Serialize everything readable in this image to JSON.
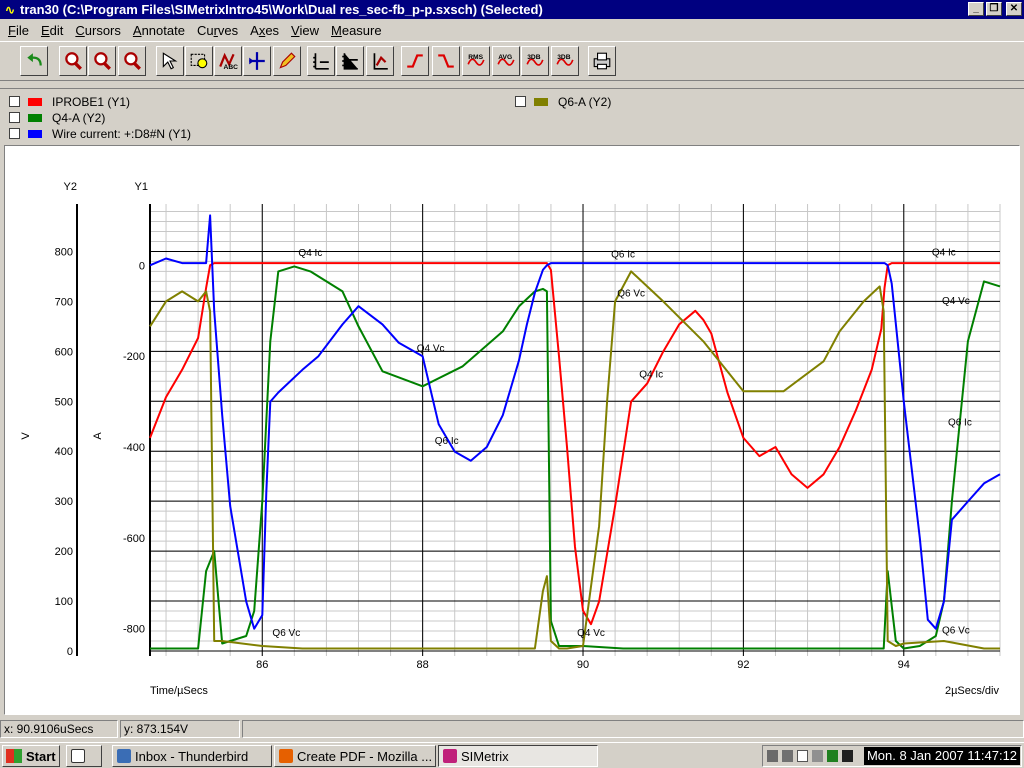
{
  "window": {
    "title": "tran30 (C:\\Program Files\\SIMetrixIntro45\\Work\\Dual res_sec-fb_p-p.sxsch) (Selected)",
    "icon": "sine-wave-icon"
  },
  "menu": [
    {
      "label": "File",
      "hot": "F",
      "rest": "ile"
    },
    {
      "label": "Edit",
      "hot": "E",
      "rest": "dit"
    },
    {
      "label": "Cursors",
      "hot": "C",
      "rest": "ursors"
    },
    {
      "label": "Annotate",
      "hot": "A",
      "rest": "nnotate"
    },
    {
      "label": "Curves",
      "pre": "Cu",
      "hot": "r",
      "rest": "ves"
    },
    {
      "label": "Axes",
      "pre": "A",
      "hot": "x",
      "rest": "es"
    },
    {
      "label": "View",
      "hot": "V",
      "rest": "iew"
    },
    {
      "label": "Measure",
      "hot": "M",
      "rest": "easure"
    }
  ],
  "toolbar": {
    "buttons": [
      {
        "name": "undo-icon"
      },
      {
        "name": "zoom-in-icon"
      },
      {
        "name": "zoom-out-icon"
      },
      {
        "name": "zoom-fit-icon"
      },
      {
        "name": "cursor-select-icon"
      },
      {
        "name": "zoom-box-icon"
      },
      {
        "name": "curve-label-icon"
      },
      {
        "name": "marker-icon"
      },
      {
        "name": "annotate-pen-icon"
      },
      {
        "name": "new-grid-icon"
      },
      {
        "name": "new-axis-icon"
      },
      {
        "name": "axis-scale-icon"
      },
      {
        "name": "rise-time-icon"
      },
      {
        "name": "fall-time-icon"
      },
      {
        "name": "rms-icon",
        "text": "RMS"
      },
      {
        "name": "avg-icon",
        "text": "AVG"
      },
      {
        "name": "3db-high-icon",
        "text": "3DB"
      },
      {
        "name": "3db-low-icon",
        "text": "3DB"
      },
      {
        "name": "print-icon"
      }
    ]
  },
  "legend": [
    {
      "label": "IPROBE1 (Y1)",
      "color": "#ff0000"
    },
    {
      "label": "Q4-A (Y2)",
      "color": "#008000"
    },
    {
      "label": "Wire current: +:D8#N (Y1)",
      "color": "#0000ff"
    },
    {
      "label": "Q6-A (Y2)",
      "color": "#808000"
    }
  ],
  "chart_data": {
    "type": "line",
    "xlabel": "Time/µSecs",
    "x_div_label": "2µSecs/div",
    "xlim": [
      84.6,
      95.2
    ],
    "x_ticks": [
      86,
      88,
      90,
      92,
      94
    ],
    "grid": true,
    "y2": {
      "title": "Y2",
      "unit_label": "V",
      "ylim": [
        -10,
        895
      ],
      "ticks": [
        0,
        100,
        200,
        300,
        400,
        500,
        600,
        700,
        800
      ]
    },
    "y1": {
      "title": "Y1",
      "unit_label": "A",
      "ylim": [
        -860,
        135
      ],
      "ticks": [
        0,
        -200,
        -400,
        -600,
        -800
      ]
    },
    "series": [
      {
        "name": "IPROBE1 (Y1)",
        "axis": "y1",
        "color": "#ff0000",
        "x": [
          84.6,
          84.8,
          85.0,
          85.2,
          85.3,
          85.35,
          85.4,
          85.5,
          86.0,
          86.5,
          87.0,
          87.5,
          88.0,
          88.5,
          89.0,
          89.4,
          89.5,
          89.55,
          89.6,
          89.7,
          89.8,
          89.9,
          90.0,
          90.1,
          90.2,
          90.4,
          90.6,
          90.8,
          91.0,
          91.2,
          91.4,
          91.5,
          91.6,
          91.8,
          92.0,
          92.2,
          92.4,
          92.6,
          92.8,
          93.0,
          93.2,
          93.4,
          93.6,
          93.72,
          93.76,
          93.8,
          93.85,
          94.0,
          94.5,
          95.0,
          95.2
        ],
        "y": [
          -380,
          -290,
          -230,
          -160,
          -50,
          0,
          5,
          5,
          5,
          5,
          5,
          5,
          5,
          5,
          5,
          5,
          5,
          5,
          -10,
          -200,
          -400,
          -620,
          -760,
          -790,
          -740,
          -530,
          -300,
          -260,
          -190,
          -130,
          -100,
          -120,
          -150,
          -280,
          -380,
          -420,
          -400,
          -460,
          -490,
          -460,
          -400,
          -320,
          -230,
          -140,
          -50,
          0,
          5,
          5,
          5,
          5,
          5
        ]
      },
      {
        "name": "Q4-A (Y2)",
        "axis": "y2",
        "color": "#008000",
        "x": [
          84.6,
          85.0,
          85.2,
          85.3,
          85.4,
          85.5,
          85.6,
          85.8,
          85.9,
          86.0,
          86.1,
          86.2,
          86.4,
          86.6,
          87.0,
          87.2,
          87.5,
          88.0,
          88.5,
          89.0,
          89.2,
          89.4,
          89.5,
          89.55,
          89.6,
          89.7,
          90.0,
          90.5,
          91.0,
          91.5,
          92.0,
          92.5,
          93.0,
          93.2,
          93.5,
          93.6,
          93.7,
          93.75,
          93.8,
          93.9,
          94.0,
          94.2,
          94.4,
          94.5,
          94.6,
          94.8,
          95.0,
          95.2
        ],
        "y": [
          5,
          5,
          5,
          160,
          200,
          15,
          20,
          30,
          80,
          300,
          620,
          760,
          770,
          760,
          720,
          650,
          560,
          530,
          570,
          640,
          690,
          720,
          725,
          720,
          60,
          10,
          10,
          5,
          5,
          5,
          5,
          5,
          5,
          5,
          5,
          5,
          5,
          5,
          160,
          20,
          5,
          10,
          30,
          100,
          300,
          620,
          740,
          730
        ]
      },
      {
        "name": "Wire current: +:D8#N (Y1)",
        "axis": "y1",
        "color": "#0000ff",
        "x": [
          84.6,
          84.8,
          85.0,
          85.2,
          85.3,
          85.35,
          85.4,
          85.5,
          85.6,
          85.8,
          85.9,
          86.0,
          86.05,
          86.1,
          86.2,
          86.5,
          86.7,
          87.0,
          87.2,
          87.5,
          87.7,
          88.0,
          88.2,
          88.4,
          88.6,
          88.8,
          89.0,
          89.2,
          89.3,
          89.4,
          89.5,
          89.55,
          89.6,
          90.0,
          90.5,
          91.0,
          92.0,
          93.0,
          93.5,
          93.72,
          93.76,
          93.8,
          93.85,
          94.0,
          94.2,
          94.3,
          94.4,
          94.5,
          94.6,
          94.8,
          95.0,
          95.2
        ],
        "y": [
          0,
          15,
          5,
          5,
          5,
          110,
          -100,
          -330,
          -530,
          -740,
          -800,
          -770,
          -500,
          -300,
          -280,
          -230,
          -200,
          -130,
          -90,
          -130,
          -170,
          -200,
          -350,
          -410,
          -430,
          -400,
          -330,
          -210,
          -130,
          -60,
          -10,
          0,
          5,
          5,
          5,
          5,
          5,
          5,
          5,
          5,
          5,
          0,
          -40,
          -300,
          -600,
          -780,
          -800,
          -740,
          -560,
          -520,
          -480,
          -460
        ]
      },
      {
        "name": "Q6-A (Y2)",
        "axis": "y2",
        "color": "#808000",
        "x": [
          84.6,
          84.8,
          85.0,
          85.2,
          85.3,
          85.35,
          85.4,
          85.5,
          86.0,
          86.5,
          87.0,
          88.0,
          89.0,
          89.4,
          89.5,
          89.55,
          89.6,
          89.7,
          89.8,
          90.0,
          90.2,
          90.3,
          90.4,
          90.6,
          91.0,
          91.5,
          92.0,
          92.5,
          93.0,
          93.2,
          93.5,
          93.7,
          93.75,
          93.8,
          93.9,
          94.0,
          94.5,
          95.0,
          95.2
        ],
        "y": [
          650,
          700,
          720,
          700,
          720,
          680,
          20,
          20,
          10,
          5,
          5,
          5,
          5,
          5,
          120,
          150,
          20,
          5,
          5,
          10,
          250,
          500,
          700,
          760,
          700,
          620,
          520,
          520,
          580,
          640,
          700,
          730,
          680,
          20,
          10,
          15,
          20,
          5,
          5
        ]
      }
    ],
    "annotations": [
      {
        "text": "Q4 Ic",
        "x": 86.6,
        "y1": 20
      },
      {
        "text": "Q6 Ic",
        "x": 90.5,
        "y1": 17
      },
      {
        "text": "Q4 Ic",
        "x": 94.5,
        "y1": 22
      },
      {
        "text": "Q6 Vc",
        "x": 90.6,
        "y2": 710
      },
      {
        "text": "Q4 Vc",
        "x": 94.65,
        "y2": 695
      },
      {
        "text": "Q4 Vc",
        "x": 88.1,
        "y2": 600
      },
      {
        "text": "Q4 Ic",
        "x": 90.85,
        "y1": -247
      },
      {
        "text": "Q6 Ic",
        "x": 88.3,
        "y1": -393
      },
      {
        "text": "Q6 Ic",
        "x": 94.7,
        "y1": -353
      },
      {
        "text": "Q6 Vc",
        "x": 86.3,
        "y2": 30
      },
      {
        "text": "Q4 Vc",
        "x": 90.1,
        "y2": 30
      },
      {
        "text": "Q6 Vc",
        "x": 94.65,
        "y2": 35
      }
    ]
  },
  "status": {
    "x_readout": "x: 90.9106uSecs",
    "y_readout": "y: 873.154V"
  },
  "taskbar": {
    "start": "Start",
    "tasks": [
      {
        "label": "Inbox - Thunderbird",
        "icon": "thunderbird-icon",
        "color": "#3a6db5"
      },
      {
        "label": "Create PDF - Mozilla ...",
        "icon": "firefox-icon",
        "color": "#e66000"
      },
      {
        "label": "SIMetrix",
        "icon": "simetrix-icon",
        "color": "#c0207a"
      }
    ],
    "clock": "Mon. 8 Jan 2007  11:47:12"
  }
}
